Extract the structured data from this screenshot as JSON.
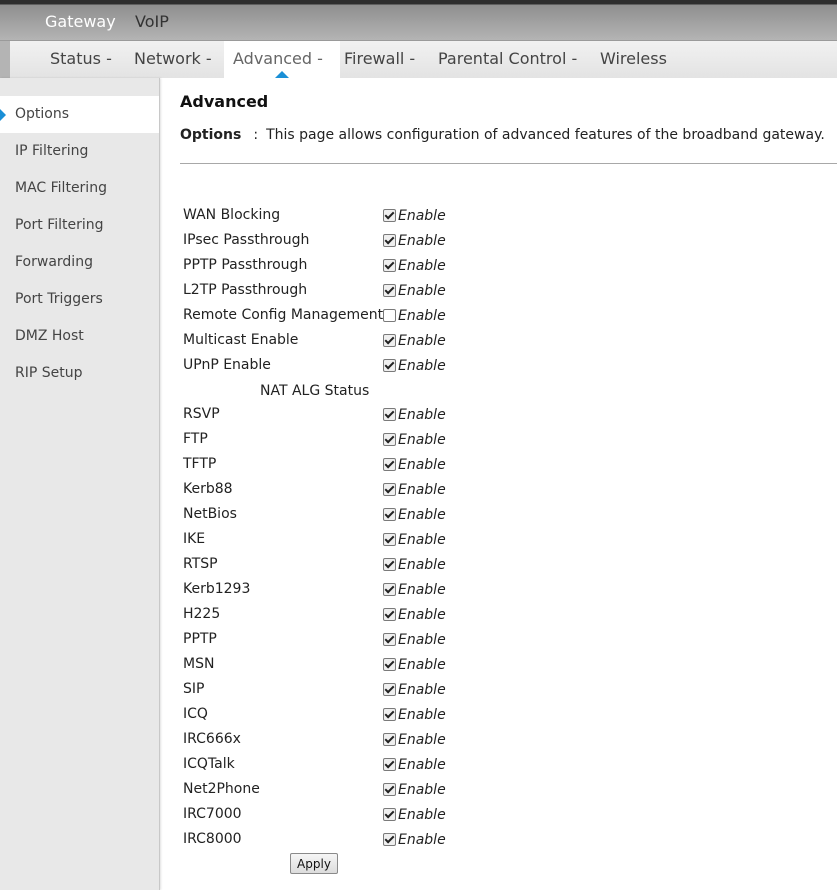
{
  "top_tabs": [
    {
      "label": "Gateway",
      "active": true
    },
    {
      "label": "VoIP",
      "active": false
    }
  ],
  "nav_tabs": [
    {
      "label": "Status -",
      "active": false
    },
    {
      "label": "Network -",
      "active": false
    },
    {
      "label": "Advanced -",
      "active": true
    },
    {
      "label": "Firewall -",
      "active": false
    },
    {
      "label": "Parental Control -",
      "active": false
    },
    {
      "label": "Wireless",
      "active": false
    }
  ],
  "sidebar": {
    "items": [
      {
        "label": "Options",
        "active": true
      },
      {
        "label": "IP Filtering",
        "active": false
      },
      {
        "label": "MAC Filtering",
        "active": false
      },
      {
        "label": "Port Filtering",
        "active": false
      },
      {
        "label": "Forwarding",
        "active": false
      },
      {
        "label": "Port Triggers",
        "active": false
      },
      {
        "label": "DMZ Host",
        "active": false
      },
      {
        "label": "RIP Setup",
        "active": false
      }
    ]
  },
  "page": {
    "title": "Advanced",
    "description_label": "Options",
    "description_sep": ":",
    "description_text": "This page allows configuration of advanced features of the broadband gateway."
  },
  "enable_label": "Enable",
  "options": [
    {
      "label": "WAN Blocking",
      "checked": true
    },
    {
      "label": "IPsec Passthrough",
      "checked": true
    },
    {
      "label": "PPTP Passthrough",
      "checked": true
    },
    {
      "label": "L2TP Passthrough",
      "checked": true
    },
    {
      "label": "Remote Config Management",
      "checked": false
    },
    {
      "label": "Multicast Enable",
      "checked": true
    },
    {
      "label": "UPnP Enable",
      "checked": true
    }
  ],
  "nat_alg_header": "NAT ALG Status",
  "nat_alg": [
    {
      "label": "RSVP",
      "checked": true
    },
    {
      "label": "FTP",
      "checked": true
    },
    {
      "label": "TFTP",
      "checked": true
    },
    {
      "label": "Kerb88",
      "checked": true
    },
    {
      "label": "NetBios",
      "checked": true
    },
    {
      "label": "IKE",
      "checked": true
    },
    {
      "label": "RTSP",
      "checked": true
    },
    {
      "label": "Kerb1293",
      "checked": true
    },
    {
      "label": "H225",
      "checked": true
    },
    {
      "label": "PPTP",
      "checked": true
    },
    {
      "label": "MSN",
      "checked": true
    },
    {
      "label": "SIP",
      "checked": true
    },
    {
      "label": "ICQ",
      "checked": true
    },
    {
      "label": "IRC666x",
      "checked": true
    },
    {
      "label": "ICQTalk",
      "checked": true
    },
    {
      "label": "Net2Phone",
      "checked": true
    },
    {
      "label": "IRC7000",
      "checked": true
    },
    {
      "label": "IRC8000",
      "checked": true
    }
  ],
  "apply_label": "Apply"
}
